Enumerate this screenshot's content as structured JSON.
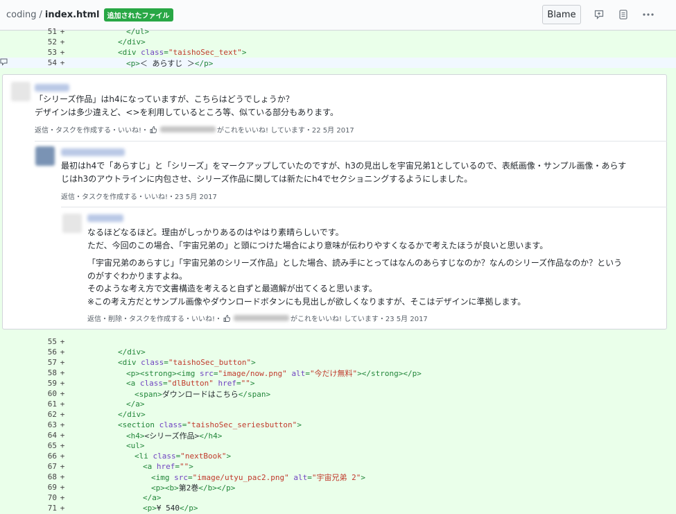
{
  "header": {
    "repo": "coding",
    "sep": "/",
    "file": "index.html",
    "badge": "追加されたファイル",
    "blame_label": "Blame"
  },
  "code_top": [
    {
      "num": "51",
      "sign": "+",
      "indent": 14,
      "parts": [
        [
          "t",
          "</ul>"
        ]
      ]
    },
    {
      "num": "52",
      "sign": "+",
      "indent": 12,
      "parts": [
        [
          "t",
          "</div>"
        ]
      ]
    },
    {
      "num": "53",
      "sign": "+",
      "indent": 12,
      "parts": [
        [
          "t",
          "<div "
        ],
        [
          "a",
          "class"
        ],
        [
          "t",
          "="
        ],
        [
          "s",
          "\"taishoSec_text\""
        ],
        [
          "t",
          ">"
        ]
      ]
    },
    {
      "num": "54",
      "sign": "+",
      "indent": 14,
      "parts": [
        [
          "t",
          "<p>"
        ],
        [
          "tx",
          "＜ あらすじ ＞"
        ],
        [
          "t",
          "</p>"
        ]
      ],
      "highlight": true
    }
  ],
  "comments": [
    {
      "lines": [
        "「シリーズ作品」はh4になっていますが、こちらはどうでしょうか？",
        "デザインは多少違えど、<>を利用しているところ等、似ている部分もあります。"
      ],
      "meta_before": "返信・タスクを作成する・いいね!・",
      "meta_after": "がこれをいいね! しています・22 5月 2017"
    },
    {
      "lines": [
        "最初はh4で「あらすじ」と「シリーズ」をマークアップしていたのですが、h3の見出しを宇宙兄弟1としているので、表紙画像・サンプル画像・あらす",
        "じはh3のアウトラインに内包させ、シリーズ作品に関しては新たにh4でセクショニングするようにしました。"
      ],
      "meta_before": "返信・タスクを作成する・いいね!・23 5月 2017"
    },
    {
      "lines": [
        "なるほどなるほど。理由がしっかりあるのはやはり素晴らしいです。",
        "ただ、今回のこの場合、「宇宙兄弟の」と頭につけた場合により意味が伝わりやすくなるかで考えたほうが良いと思います。"
      ],
      "lines2": [
        "「宇宙兄弟のあらすじ」「宇宙兄弟のシリーズ作品」とした場合、読み手にとってはなんのあらすじなのか？なんのシリーズ作品なのか？という",
        "のがすぐわかりますよね。",
        "そのような考え方で文書構造を考えると自ずと最適解が出てくると思います。",
        "※この考え方だとサンプル画像やダウンロードボタンにも見出しが欲しくなりますが、そこはデザインに準拠します。"
      ],
      "meta_before": "返信・削除・タスクを作成する・いいね!・",
      "meta_after": "がこれをいいね! しています・23 5月 2017"
    }
  ],
  "code_bottom": [
    {
      "num": "55",
      "sign": "+",
      "indent": 0,
      "parts": []
    },
    {
      "num": "56",
      "sign": "+",
      "indent": 12,
      "parts": [
        [
          "t",
          "</div>"
        ]
      ]
    },
    {
      "num": "57",
      "sign": "+",
      "indent": 12,
      "parts": [
        [
          "t",
          "<div "
        ],
        [
          "a",
          "class"
        ],
        [
          "t",
          "="
        ],
        [
          "s",
          "\"taishoSec_button\""
        ],
        [
          "t",
          ">"
        ]
      ]
    },
    {
      "num": "58",
      "sign": "+",
      "indent": 14,
      "parts": [
        [
          "t",
          "<p><strong><img "
        ],
        [
          "a",
          "src"
        ],
        [
          "t",
          "="
        ],
        [
          "s",
          "\"image/now.png\""
        ],
        [
          "t",
          " "
        ],
        [
          "a",
          "alt"
        ],
        [
          "t",
          "="
        ],
        [
          "s",
          "\"今だけ無料\""
        ],
        [
          "t",
          "></strong></p>"
        ]
      ]
    },
    {
      "num": "59",
      "sign": "+",
      "indent": 14,
      "parts": [
        [
          "t",
          "<a "
        ],
        [
          "a",
          "class"
        ],
        [
          "t",
          "="
        ],
        [
          "s",
          "\"dlButton\""
        ],
        [
          "t",
          " "
        ],
        [
          "a",
          "href"
        ],
        [
          "t",
          "="
        ],
        [
          "s",
          "\"\""
        ],
        [
          "t",
          ">"
        ]
      ]
    },
    {
      "num": "60",
      "sign": "+",
      "indent": 16,
      "parts": [
        [
          "t",
          "<span>"
        ],
        [
          "tx",
          "ダウンロードはこちら"
        ],
        [
          "t",
          "</span>"
        ]
      ]
    },
    {
      "num": "61",
      "sign": "+",
      "indent": 14,
      "parts": [
        [
          "t",
          "</a>"
        ]
      ]
    },
    {
      "num": "62",
      "sign": "+",
      "indent": 12,
      "parts": [
        [
          "t",
          "</div>"
        ]
      ]
    },
    {
      "num": "63",
      "sign": "+",
      "indent": 12,
      "parts": [
        [
          "t",
          "<section "
        ],
        [
          "a",
          "class"
        ],
        [
          "t",
          "="
        ],
        [
          "s",
          "\"taishoSec_seriesbutton\""
        ],
        [
          "t",
          ">"
        ]
      ]
    },
    {
      "num": "64",
      "sign": "+",
      "indent": 14,
      "parts": [
        [
          "t",
          "<h4>"
        ],
        [
          "tx",
          "<シリーズ作品>"
        ],
        [
          "t",
          "</h4>"
        ]
      ]
    },
    {
      "num": "65",
      "sign": "+",
      "indent": 14,
      "parts": [
        [
          "t",
          "<ul>"
        ]
      ]
    },
    {
      "num": "66",
      "sign": "+",
      "indent": 16,
      "parts": [
        [
          "t",
          "<li "
        ],
        [
          "a",
          "class"
        ],
        [
          "t",
          "="
        ],
        [
          "s",
          "\"nextBook\""
        ],
        [
          "t",
          ">"
        ]
      ]
    },
    {
      "num": "67",
      "sign": "+",
      "indent": 18,
      "parts": [
        [
          "t",
          "<a "
        ],
        [
          "a",
          "href"
        ],
        [
          "t",
          "="
        ],
        [
          "s",
          "\"\""
        ],
        [
          "t",
          ">"
        ]
      ]
    },
    {
      "num": "68",
      "sign": "+",
      "indent": 20,
      "parts": [
        [
          "t",
          "<img "
        ],
        [
          "a",
          "src"
        ],
        [
          "t",
          "="
        ],
        [
          "s",
          "\"image/utyu_pac2.png\""
        ],
        [
          "t",
          " "
        ],
        [
          "a",
          "alt"
        ],
        [
          "t",
          "="
        ],
        [
          "s",
          "\"宇宙兄弟 2\""
        ],
        [
          "t",
          ">"
        ]
      ]
    },
    {
      "num": "69",
      "sign": "+",
      "indent": 20,
      "parts": [
        [
          "t",
          "<p><b>"
        ],
        [
          "tx",
          "第2巻"
        ],
        [
          "t",
          "</b></p>"
        ]
      ]
    },
    {
      "num": "70",
      "sign": "+",
      "indent": 18,
      "parts": [
        [
          "t",
          "</a>"
        ]
      ]
    },
    {
      "num": "71",
      "sign": "+",
      "indent": 18,
      "parts": [
        [
          "t",
          "<p>"
        ],
        [
          "tx",
          "¥ 540"
        ],
        [
          "t",
          "</p>"
        ]
      ]
    }
  ],
  "icons": {
    "comment_add": "comment-add-icon",
    "file": "file-icon",
    "more": "kebab-horizontal-icon",
    "thumb": "thumbs-up-icon"
  }
}
